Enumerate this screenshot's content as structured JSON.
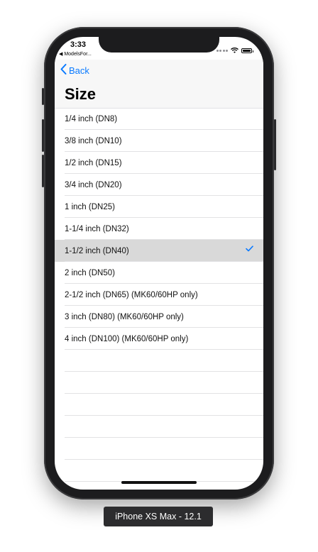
{
  "status_bar": {
    "time": "3:33",
    "back_to_app": "◀ ModelsFor..."
  },
  "navbar": {
    "back_label": "Back",
    "title": "Size"
  },
  "list": {
    "items": [
      {
        "label": "1/4 inch (DN8)",
        "selected": false
      },
      {
        "label": "3/8 inch (DN10)",
        "selected": false
      },
      {
        "label": "1/2 inch (DN15)",
        "selected": false
      },
      {
        "label": "3/4 inch (DN20)",
        "selected": false
      },
      {
        "label": "1 inch (DN25)",
        "selected": false
      },
      {
        "label": "1-1/4 inch (DN32)",
        "selected": false
      },
      {
        "label": "1-1/2 inch (DN40)",
        "selected": true
      },
      {
        "label": "2 inch (DN50)",
        "selected": false
      },
      {
        "label": "2-1/2 inch (DN65) (MK60/60HP only)",
        "selected": false
      },
      {
        "label": "3 inch (DN80) (MK60/60HP only)",
        "selected": false
      },
      {
        "label": "4 inch (DN100) (MK60/60HP only)",
        "selected": false
      }
    ]
  },
  "device_label": "iPhone XS Max - 12.1",
  "colors": {
    "accent": "#0a7aff",
    "selected_row": "#d9d9d9",
    "device_frame": "#1c1c1e"
  }
}
